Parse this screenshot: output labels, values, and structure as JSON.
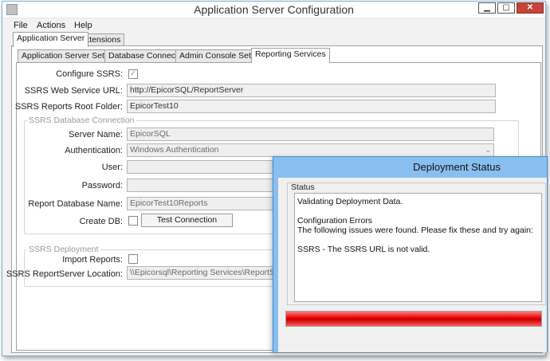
{
  "window": {
    "title": "Application Server Configuration"
  },
  "window_controls": {
    "minimize": "▁",
    "maximize": "▢",
    "close": "✕"
  },
  "menu": {
    "file": "File",
    "actions": "Actions",
    "help": "Help"
  },
  "outer_tabs": {
    "app_server": "Application Server",
    "extensions": "Extensions"
  },
  "inner_tabs": {
    "settings": "Application Server Settings",
    "database": "Database Connection",
    "admin": "Admin Console Settings",
    "reporting": "Reporting Services"
  },
  "form": {
    "configure_ssrs_label": "Configure SSRS:",
    "configure_ssrs_checked": "✓",
    "web_service_url_label": "SSRS Web Service URL:",
    "web_service_url_value": "http://EpicorSQL/ReportServer",
    "reports_root_label": "SSRS Reports Root Folder:",
    "reports_root_value": "EpicorTest10",
    "db_group_title": "SSRS Database Connection",
    "server_name_label": "Server Name:",
    "server_name_value": "EpicorSQL",
    "authentication_label": "Authentication:",
    "authentication_value": "Windows Authentication",
    "user_label": "User:",
    "user_value": "",
    "password_label": "Password:",
    "password_value": "",
    "report_db_name_label": "Report Database Name:",
    "report_db_name_value": "EpicorTest10Reports",
    "create_db_label": "Create DB:",
    "test_connection_button": "Test Connection",
    "deployment_group_title": "SSRS Deployment",
    "import_reports_label": "Import Reports:",
    "reportserver_location_label": "SSRS ReportServer Location:",
    "reportserver_location_value": "\\\\Epicorsql\\Reporting Services\\ReportServer"
  },
  "dialog": {
    "title": "Deployment Status",
    "status_label": "Status",
    "lines": [
      "Validating Deployment Data.",
      "",
      "Configuration Errors",
      "The following issues were found. Please fix these and try again:",
      "",
      "SSRS - The SSRS URL is not valid."
    ],
    "progress_fraction": 1.0,
    "progress_color": "#e60000"
  },
  "colors": {
    "accent": "#89bff0",
    "error": "#e60000"
  }
}
